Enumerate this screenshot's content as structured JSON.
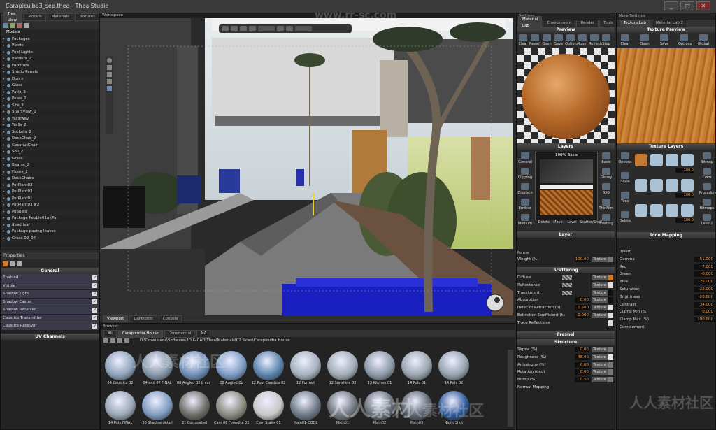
{
  "window": {
    "title": "Carapicuiba3_sep.thea - Thea Studio",
    "min": "_",
    "max": "□",
    "close": "✕"
  },
  "tree_panel": {
    "tabs": [
      "Tree View",
      "Models",
      "Materials",
      "Textures"
    ],
    "root": "Models",
    "items": [
      "Packages",
      "Plants",
      "Pool Lights",
      "Barriers_2",
      "Furniture",
      "Studio Panels",
      "Doors",
      "Glass",
      "Patio_3",
      "Poles_2",
      "Site_3",
      "StairsView_2",
      "Walkway",
      "Walls_2",
      "Sockets_2",
      "DeckChair_2",
      "CoconutChair",
      "Soil_2",
      "Grass",
      "Beams_2",
      "Floors_2",
      "DeckChairs",
      "PotPlant02",
      "PotPlant03",
      "PotPlant01",
      "PotPlant03 #2",
      "Pebbles",
      "Package Pebble01a (Pa",
      "dead leaf",
      "Package paving leaves",
      "Grass 02_04"
    ]
  },
  "properties": {
    "title": "Properties",
    "section": "General",
    "rows": [
      "Enabled",
      "Visible",
      "Shadow Tight",
      "Shadow Caster",
      "Shadow Receiver",
      "Caustics Transmitter",
      "Caustics Receiver"
    ],
    "uv_section": "UV Channels"
  },
  "viewport": {
    "label": "Workspace",
    "tabs": [
      "Viewport",
      "Darkroom",
      "Console"
    ],
    "scene_alt": "Architectural courtyard render with tree, plants and concrete walkway"
  },
  "browser": {
    "label": "Browser",
    "path": "D:\\Downloads\\Software\\3D & CAD\\Thea\\Materials\\02 Skies\\Carapicuiba House",
    "tabs": [
      "All",
      "Carapicuiba House",
      "Commercial",
      "NA"
    ],
    "items": [
      {
        "label": "04 Caustics 02",
        "color": "#8ea4bb"
      },
      {
        "label": "04 and 07 FINAL",
        "color": "#8698ab"
      },
      {
        "label": "08 Angled 02 b var 1",
        "color": "#6f8fb5"
      },
      {
        "label": "08 Angled 2b",
        "color": "#7b9cc5"
      },
      {
        "label": "12 Pool Caustics 02",
        "color": "#5a84ad"
      },
      {
        "label": "12 Portrait",
        "color": "#a5b1bd"
      },
      {
        "label": "12 Sunshine 02",
        "color": "#a2acb6"
      },
      {
        "label": "13 Kitchen 01",
        "color": "#8c9aa8"
      },
      {
        "label": "14 Pots 01",
        "color": "#9aa5af"
      },
      {
        "label": "14 Pots 02",
        "color": "#95a3b0"
      },
      {
        "label": "14 Pots FINAL",
        "color": "#9aa7b5"
      },
      {
        "label": "20 Shadow detail",
        "color": "#7f9dc0"
      },
      {
        "label": "21 Corrugated",
        "color": "#6d6d66"
      },
      {
        "label": "Cam 08 Forsythe 01",
        "color": "#8a8a7e"
      },
      {
        "label": "Cam Stairs 01",
        "color": "#c8c8c8"
      },
      {
        "label": "Main01-COOL",
        "color": "#6f7a86"
      },
      {
        "label": "Main01",
        "color": "#707880"
      },
      {
        "label": "Main02",
        "color": "#6a737c"
      },
      {
        "label": "Main03",
        "color": "#5d6670"
      },
      {
        "label": "Night Shot",
        "color": "#2f5a99"
      }
    ]
  },
  "settings": {
    "label": "Settings",
    "tabs": [
      "Material Lab",
      "Environment",
      "Render",
      "Tools"
    ],
    "preview_title": "Preview",
    "preview_tools": [
      "Clear",
      "Revert",
      "Open",
      "Save",
      "Options",
      "Room",
      "Refresh",
      "Stop"
    ],
    "layers_title": "Layers",
    "layer_name": "100% Basic",
    "layer_tools_left": [
      "General",
      "Clipping",
      "Displace",
      "Emitter",
      "Medium"
    ],
    "layer_tools_right": [
      "Basic",
      "Glossy",
      "SSS",
      "ThinFilm",
      "Coating"
    ],
    "layer_bottom_tools": [
      "Delete",
      "Move",
      "Level",
      "Scatter/Shell"
    ],
    "layer_section": "Layer",
    "name_label": "Name",
    "weight_label": "Weight (%)",
    "weight_value": "100.00",
    "texture_btn": "Texture",
    "scattering_title": "Scattering",
    "scattering_rows": [
      {
        "label": "Diffuse",
        "value": "",
        "swatch": "#c97a2b"
      },
      {
        "label": "Reflectance",
        "value": "",
        "swatch": "#e0e0e0"
      },
      {
        "label": "Translucent",
        "value": "",
        "swatch": "#101010"
      },
      {
        "label": "Absorption",
        "value": "0.00",
        "swatch": "#101010"
      },
      {
        "label": "Index of Refraction (n)",
        "value": "1.500",
        "swatch": "#e0e0e0"
      },
      {
        "label": "Extinction Coefficient (k)",
        "value": "0.000",
        "swatch": "#e0e0e0"
      },
      {
        "label": "Trace Reflections",
        "value": "",
        "swatch": ""
      }
    ],
    "fresnel_title": "Fresnel",
    "structure_title": "Structure",
    "structure_rows": [
      {
        "label": "Sigma (%)",
        "value": "0.00"
      },
      {
        "label": "Roughness (%)",
        "value": "45.00"
      },
      {
        "label": "Anisotropy (%)",
        "value": "0.00"
      },
      {
        "label": "Rotation (deg)",
        "value": "0.00"
      },
      {
        "label": "Bump (%)",
        "value": "0.50"
      },
      {
        "label": "Normal Mapping",
        "value": ""
      }
    ]
  },
  "more_settings": {
    "label": "More Settings",
    "tabs": [
      "Texture Lab",
      "Material Lab 2"
    ],
    "preview_title": "Texture Preview",
    "preview_tools": [
      "Clear",
      "Open",
      "Save",
      "Options",
      "Global"
    ],
    "layers_title": "Texture Layers",
    "layer_tools_left": [
      "Options",
      "Scale",
      "Tone",
      "Delete"
    ],
    "layer_tools_right": [
      "Bitmap",
      "Color",
      "Procedural",
      "Bitmaps",
      "Level2"
    ],
    "layer_values": [
      "100.0",
      "100.0",
      "100.0"
    ],
    "tone_title": "Tone Mapping",
    "tone_rows": [
      {
        "label": "Invert",
        "value": ""
      },
      {
        "label": "Gamma",
        "value": "-51.000"
      },
      {
        "label": "Red",
        "value": "7.000"
      },
      {
        "label": "Green",
        "value": "-0.000"
      },
      {
        "label": "Blue",
        "value": "-25.000"
      },
      {
        "label": "Saturation",
        "value": "-22.000"
      },
      {
        "label": "Brightness",
        "value": "-20.000"
      },
      {
        "label": "Contrast",
        "value": "34.000"
      },
      {
        "label": "Clamp Min (%)",
        "value": "0.000"
      },
      {
        "label": "Clamp Max (%)",
        "value": "100.000"
      },
      {
        "label": "Complement",
        "value": ""
      }
    ]
  },
  "watermarks": [
    "www.rr-sc.com",
    "人人素材社区",
    "人人素材社区",
    "人人素材社区",
    "人人素材"
  ]
}
